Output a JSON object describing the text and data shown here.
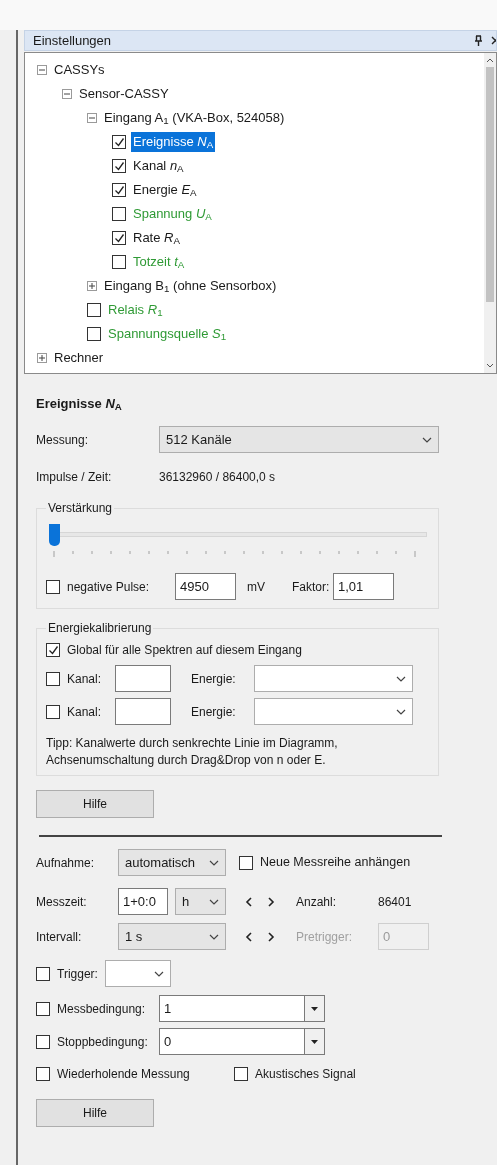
{
  "panel": {
    "title": "Einstellungen"
  },
  "tree": [
    {
      "kind": "node",
      "label": "CASSYs",
      "expanded": true,
      "selected": false,
      "children": [
        {
          "kind": "node",
          "label": "Sensor-CASSY",
          "expanded": true,
          "selected": false,
          "children": [
            {
              "kind": "node",
              "label": "Eingang A$_{1}$ (VKA-Box, 524058)",
              "expanded": true,
              "selected": false,
              "children": [
                {
                  "kind": "check",
                  "label": "Ereignisse *N*$_{A}$",
                  "checked": true,
                  "selected": true
                },
                {
                  "kind": "check",
                  "label": "Kanal *n*$_{A}$",
                  "checked": true,
                  "selected": false
                },
                {
                  "kind": "check",
                  "label": "Energie *E*$_{A}$",
                  "checked": true,
                  "selected": false
                },
                {
                  "kind": "check",
                  "label": "Spannung *U*$_{A}$",
                  "checked": false,
                  "selected": false,
                  "color": "#2f9a35"
                },
                {
                  "kind": "check",
                  "label": "Rate *R*$_{A}$",
                  "checked": true,
                  "selected": false
                },
                {
                  "kind": "check",
                  "label": "Totzeit *t*$_{A}$",
                  "checked": false,
                  "selected": false,
                  "color": "#2f9a35"
                }
              ]
            },
            {
              "kind": "node",
              "label": "Eingang B$_{1}$ (ohne Sensorbox)",
              "expanded": false,
              "selected": false
            },
            {
              "kind": "check",
              "label": "Relais *R*$_{1}$",
              "checked": false,
              "selected": false,
              "color": "#2f9a35"
            },
            {
              "kind": "check",
              "label": "Spannungsquelle *S*$_{1}$",
              "checked": false,
              "selected": false,
              "color": "#2f9a35"
            }
          ]
        }
      ]
    },
    {
      "kind": "node",
      "label": "Rechner",
      "expanded": false,
      "selected": false
    }
  ],
  "details": {
    "title": "Ereignisse *N*$_{A}$",
    "messung": {
      "label": "Messung:",
      "value": "512 Kanäle"
    },
    "impulse": {
      "label": "Impulse / Zeit:",
      "value": "36132960 / 86400,0 s"
    },
    "verstaerkung": {
      "title": "Verstärkung",
      "slider": {
        "level": 0
      },
      "negative": {
        "label": "negative Pulse:",
        "checked": false,
        "value": "4950",
        "unit": "mV"
      },
      "faktor": {
        "label": "Faktor:",
        "value": "1,01"
      }
    },
    "energiekalibrierung": {
      "title": "Energiekalibrierung",
      "global": {
        "label": "Global für alle Spektren auf diesem Eingang",
        "checked": true
      },
      "rows": [
        {
          "checked": false,
          "kanal_label": "Kanal:",
          "energie_label": "Energie:"
        },
        {
          "checked": false,
          "kanal_label": "Kanal:",
          "energie_label": "Energie:"
        }
      ],
      "tip": "Tipp: Kanalwerte durch senkrechte Linie im Diagramm,\nAchsenumschaltung durch Drag&Drop von n oder E."
    },
    "help_button": "Hilfe"
  },
  "recording": {
    "aufnahme": {
      "label": "Aufnahme:",
      "value": "automatisch"
    },
    "append": {
      "label": "Neue Messreihe anhängen",
      "checked": false
    },
    "messzeit": {
      "label": "Messzeit:",
      "value": "1+0:0",
      "unit": "h"
    },
    "anzahl": {
      "label": "Anzahl:",
      "value": "86401"
    },
    "intervall": {
      "label": "Intervall:",
      "value": "1 s"
    },
    "pretrigger": {
      "label": "Pretrigger:",
      "value": "0",
      "disabled": true
    },
    "trigger": {
      "label": "Trigger:",
      "checked": false
    },
    "messbedingung": {
      "label": "Messbedingung:",
      "checked": false,
      "value": "1"
    },
    "stoppbedingung": {
      "label": "Stoppbedingung:",
      "checked": false,
      "value": "0"
    },
    "wiederholend": {
      "label": "Wiederholende Messung",
      "checked": false
    },
    "akustisch": {
      "label": "Akustisches Signal",
      "checked": false
    },
    "help_button": "Hilfe"
  }
}
